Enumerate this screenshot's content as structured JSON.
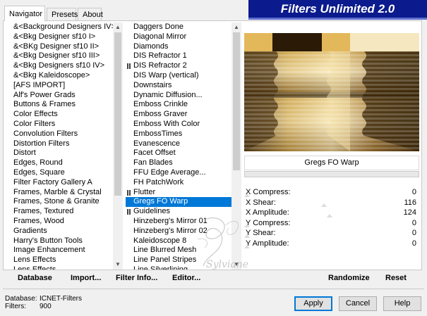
{
  "tabs": [
    {
      "label": "Navigator"
    },
    {
      "label": "Presets"
    },
    {
      "label": "About"
    }
  ],
  "title": "Filters Unlimited 2.0",
  "categories": [
    "&<Background Designers IV>",
    "&<Bkg Designer sf10 I>",
    "&<BKg Designer sf10 II>",
    "&<Bkg Designer sf10 III>",
    "&<Bkg Designers sf10 IV>",
    "&<Bkg Kaleidoscope>",
    "[AFS IMPORT]",
    "Alf's Power Grads",
    "Buttons & Frames",
    "Color Effects",
    "Color Filters",
    "Convolution Filters",
    "Distortion Filters",
    "Distort",
    "Edges, Round",
    "Edges, Square",
    "Filter Factory Gallery A",
    "Frames, Marble & Crystal",
    "Frames, Stone & Granite",
    "Frames, Textured",
    "Frames, Wood",
    "Gradients",
    "Harry's Button Tools",
    "Image Enhancement",
    "Lens Effects",
    "Lens Effects"
  ],
  "filters": [
    {
      "label": "Daggers Done",
      "group": false
    },
    {
      "label": "Diagonal Mirror",
      "group": false
    },
    {
      "label": "Diamonds",
      "group": false
    },
    {
      "label": "DIS Refractor 1",
      "group": false
    },
    {
      "label": "DIS Refractor 2",
      "group": true
    },
    {
      "label": "DIS Warp (vertical)",
      "group": false
    },
    {
      "label": "Downstairs",
      "group": false
    },
    {
      "label": "Dynamic Diffusion...",
      "group": false
    },
    {
      "label": "Emboss Crinkle",
      "group": false
    },
    {
      "label": "Emboss Graver",
      "group": false
    },
    {
      "label": "Emboss With Color",
      "group": false
    },
    {
      "label": "EmbossTimes",
      "group": false
    },
    {
      "label": "Evanescence",
      "group": false
    },
    {
      "label": "Facet Offset",
      "group": false
    },
    {
      "label": "Fan Blades",
      "group": false
    },
    {
      "label": "FFU Edge Average...",
      "group": false
    },
    {
      "label": "FH PatchWork",
      "group": false
    },
    {
      "label": "Flutter",
      "group": true
    },
    {
      "label": "Gregs FO Warp",
      "group": false,
      "selected": true
    },
    {
      "label": "Guidelines",
      "group": true
    },
    {
      "label": "Hinzeberg's Mirror 01",
      "group": false
    },
    {
      "label": "Hinzeberg's Mirror 02",
      "group": false
    },
    {
      "label": "Kaleidoscope 8",
      "group": false
    },
    {
      "label": "Line Blurred Mesh",
      "group": false
    },
    {
      "label": "Line Panel Stripes",
      "group": false
    },
    {
      "label": "Line Silverlining",
      "group": false
    }
  ],
  "selected_filter": "Gregs FO Warp",
  "params": [
    {
      "name": "X Compress:",
      "value": "0",
      "level": 0.0
    },
    {
      "name": "X Shear:",
      "value": "116",
      "level": 0.455
    },
    {
      "name": "X Amplitude:",
      "value": "124",
      "level": 0.486
    },
    {
      "name": "Y Compress:",
      "value": "0",
      "level": 0.0
    },
    {
      "name": "Y Shear:",
      "value": "0",
      "level": 0.0
    },
    {
      "name": "Y Amplitude:",
      "value": "0",
      "level": 0.0
    }
  ],
  "toolbar": {
    "database_label": "Database",
    "import_label": "Import...",
    "filter_info_label": "Filter Info...",
    "editor_label": "Editor...",
    "randomize_label": "Randomize",
    "reset_label": "Reset"
  },
  "footer": {
    "database_label": "Database:",
    "database_value": "ICNET-Filters",
    "filters_label": "Filters:",
    "filters_value": "900"
  },
  "buttons": {
    "apply": "Apply",
    "cancel": "Cancel",
    "help": "Help"
  },
  "watermark": "Sylviane",
  "colors": {
    "title_bg": "#0b1a8c",
    "selection": "#0078d7"
  }
}
